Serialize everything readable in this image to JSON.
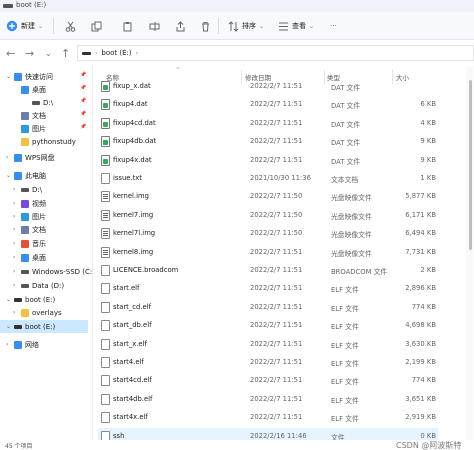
{
  "window": {
    "title": "boot (E:)"
  },
  "toolbar": {
    "new_label": "新建",
    "sort_label": "排序",
    "view_label": "查看",
    "more_label": "···"
  },
  "address": {
    "path": "boot (E:)"
  },
  "sidebar": {
    "items": [
      {
        "label": "快速访问",
        "icon": "star-icon",
        "color": "#3b8ee8"
      },
      {
        "label": "桌面",
        "icon": "desktop-icon",
        "color": "#3b8ee8"
      },
      {
        "label": "D:\\",
        "icon": "drive-icon",
        "color": "#555555"
      },
      {
        "label": "文档",
        "icon": "documents-icon",
        "color": "#6a7ea6"
      },
      {
        "label": "图片",
        "icon": "pictures-icon",
        "color": "#2f9ad8"
      },
      {
        "label": "pythonstudy",
        "icon": "folder-icon",
        "color": "#f3c043"
      },
      {
        "label": "WPS网盘",
        "icon": "cloud-icon",
        "color": "#3b8ee8"
      },
      {
        "label": "此电脑",
        "icon": "pc-icon",
        "color": "#3b8ee8"
      },
      {
        "label": "D:\\",
        "icon": "drive-icon",
        "color": "#555555"
      },
      {
        "label": "视频",
        "icon": "videos-icon",
        "color": "#7b4bd6"
      },
      {
        "label": "图片",
        "icon": "pictures-icon",
        "color": "#2f9ad8"
      },
      {
        "label": "文档",
        "icon": "documents-icon",
        "color": "#6a7ea6"
      },
      {
        "label": "音乐",
        "icon": "music-icon",
        "color": "#e2513a"
      },
      {
        "label": "桌面",
        "icon": "desktop-icon",
        "color": "#3b8ee8"
      },
      {
        "label": "Windows-SSD (C:)",
        "icon": "drive-icon",
        "color": "#555555"
      },
      {
        "label": "Data (D:)",
        "icon": "drive-icon",
        "color": "#555555"
      },
      {
        "label": "boot (E:)",
        "icon": "drive-icon",
        "color": "#333333"
      },
      {
        "label": "overlays",
        "icon": "folder-icon",
        "color": "#f3c043"
      },
      {
        "label": "boot (E:)",
        "icon": "drive-icon",
        "color": "#333333"
      },
      {
        "label": "网络",
        "icon": "network-icon",
        "color": "#3b8ee8"
      }
    ]
  },
  "columns": {
    "name": "名称",
    "date": "修改日期",
    "type": "类型",
    "size": "大小"
  },
  "files": [
    {
      "name": "fixup_x.dat",
      "date": "2022/2/7 11:51",
      "type": "DAT 文件",
      "size": "",
      "icon": "dat"
    },
    {
      "name": "fixup4.dat",
      "date": "2022/2/7 11:51",
      "type": "DAT 文件",
      "size": "6 KB",
      "icon": "dat"
    },
    {
      "name": "fixup4cd.dat",
      "date": "2022/2/7 11:51",
      "type": "DAT 文件",
      "size": "4 KB",
      "icon": "dat"
    },
    {
      "name": "fixup4db.dat",
      "date": "2022/2/7 11:51",
      "type": "DAT 文件",
      "size": "9 KB",
      "icon": "dat"
    },
    {
      "name": "fixup4x.dat",
      "date": "2022/2/7 11:51",
      "type": "DAT 文件",
      "size": "9 KB",
      "icon": "dat"
    },
    {
      "name": "issue.txt",
      "date": "2021/10/30 11:36",
      "type": "文本文档",
      "size": "1 KB",
      "icon": "txt"
    },
    {
      "name": "kernel.img",
      "date": "2022/2/7 11:50",
      "type": "光盘映像文件",
      "size": "5,877 KB",
      "icon": "img"
    },
    {
      "name": "kernel7.img",
      "date": "2022/2/7 11:50",
      "type": "光盘映像文件",
      "size": "6,171 KB",
      "icon": "img"
    },
    {
      "name": "kernel7l.img",
      "date": "2022/2/7 11:50",
      "type": "光盘映像文件",
      "size": "6,494 KB",
      "icon": "img"
    },
    {
      "name": "kernel8.img",
      "date": "2022/2/7 11:51",
      "type": "光盘映像文件",
      "size": "7,731 KB",
      "icon": "img"
    },
    {
      "name": "LICENCE.broadcom",
      "date": "2022/2/7 11:51",
      "type": "BROADCOM 文件",
      "size": "2 KB",
      "icon": "txt"
    },
    {
      "name": "start.elf",
      "date": "2022/2/7 11:51",
      "type": "ELF 文件",
      "size": "2,896 KB",
      "icon": "txt"
    },
    {
      "name": "start_cd.elf",
      "date": "2022/2/7 11:51",
      "type": "ELF 文件",
      "size": "774 KB",
      "icon": "txt"
    },
    {
      "name": "start_db.elf",
      "date": "2022/2/7 11:51",
      "type": "ELF 文件",
      "size": "4,698 KB",
      "icon": "txt"
    },
    {
      "name": "start_x.elf",
      "date": "2022/2/7 11:51",
      "type": "ELF 文件",
      "size": "3,630 KB",
      "icon": "txt"
    },
    {
      "name": "start4.elf",
      "date": "2022/2/7 11:51",
      "type": "ELF 文件",
      "size": "2,199 KB",
      "icon": "txt"
    },
    {
      "name": "start4cd.elf",
      "date": "2022/2/7 11:51",
      "type": "ELF 文件",
      "size": "774 KB",
      "icon": "txt"
    },
    {
      "name": "start4db.elf",
      "date": "2022/2/7 11:51",
      "type": "ELF 文件",
      "size": "3,651 KB",
      "icon": "txt"
    },
    {
      "name": "start4x.elf",
      "date": "2022/2/7 11:51",
      "type": "ELF 文件",
      "size": "2,919 KB",
      "icon": "txt"
    },
    {
      "name": "ssh",
      "date": "2022/2/16 11:46",
      "type": "文件",
      "size": "0 KB",
      "icon": "txt"
    }
  ],
  "status": {
    "count": "45 个项目"
  },
  "watermark": "CSDN @阿波斯特"
}
